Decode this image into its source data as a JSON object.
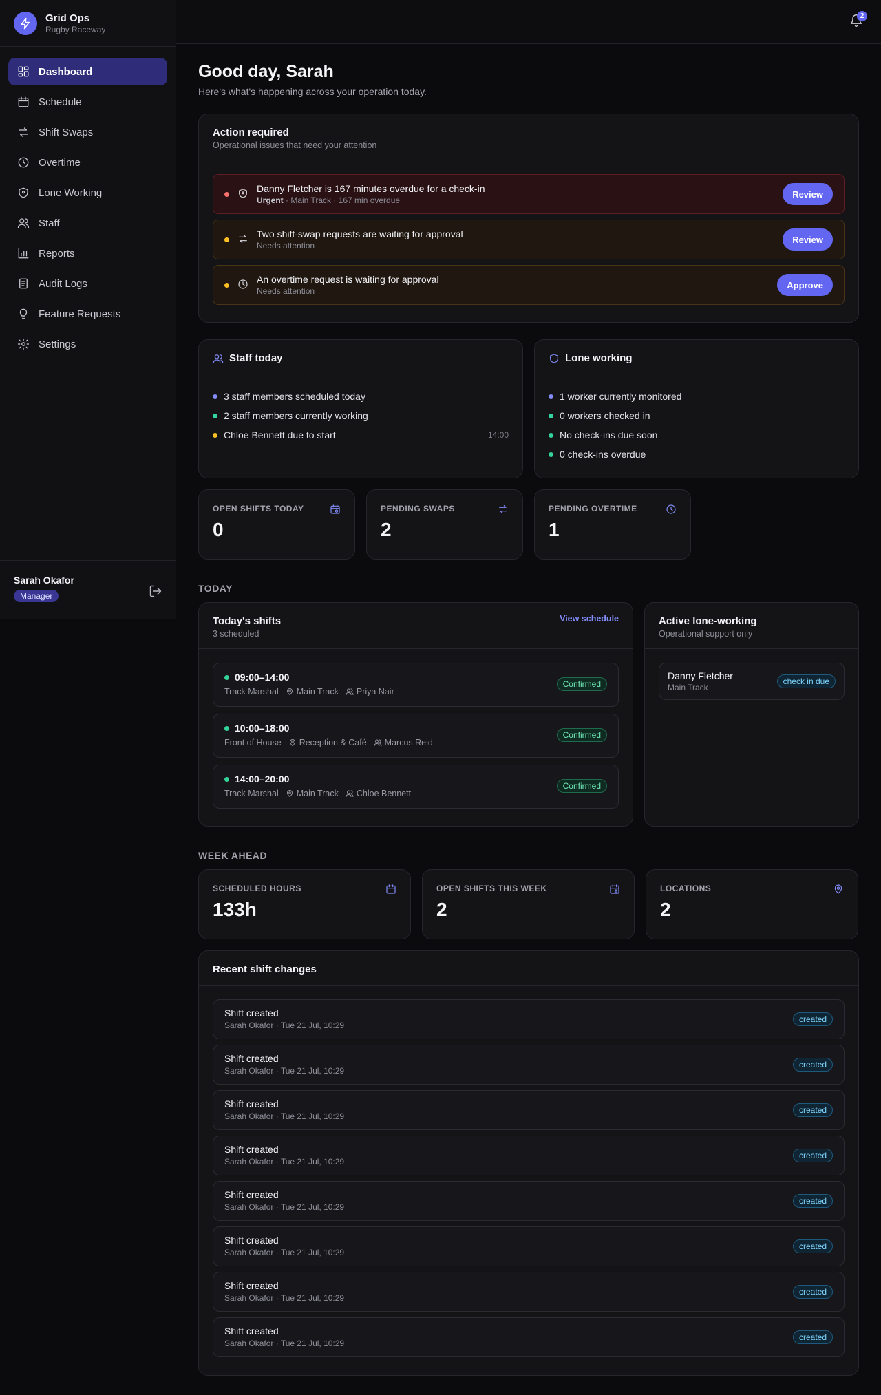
{
  "app": {
    "name": "Grid Ops",
    "venue": "Rugby Raceway"
  },
  "colors": {
    "accent": "#6366f1",
    "urgent": "#f87171",
    "warn": "#fbbf24",
    "ok": "#34d399",
    "info": "#818cf8"
  },
  "sidebar": {
    "items": [
      {
        "label": "Dashboard",
        "icon": "dashboard-icon",
        "active": true
      },
      {
        "label": "Schedule",
        "icon": "calendar-icon"
      },
      {
        "label": "Shift Swaps",
        "icon": "swap-icon"
      },
      {
        "label": "Overtime",
        "icon": "clock-icon"
      },
      {
        "label": "Lone Working",
        "icon": "shield-icon"
      },
      {
        "label": "Staff",
        "icon": "users-icon"
      },
      {
        "label": "Reports",
        "icon": "bar-chart-icon"
      },
      {
        "label": "Audit Logs",
        "icon": "log-icon"
      },
      {
        "label": "Feature Requests",
        "icon": "lightbulb-icon"
      },
      {
        "label": "Settings",
        "icon": "gear-icon"
      }
    ],
    "user": {
      "name": "Sarah Okafor",
      "role": "Manager"
    }
  },
  "topbar": {
    "notifications": "2"
  },
  "header": {
    "greeting": "Good day, Sarah",
    "subtitle": "Here's what's happening across your operation today."
  },
  "actions": {
    "title": "Action required",
    "subtitle": "Operational issues that need your attention",
    "items": [
      {
        "title": "Danny Fletcher is 167 minutes overdue for a check-in",
        "severity": "Urgent",
        "meta": " · Main Track · 167 min overdue",
        "button": "Review"
      },
      {
        "title": "Two shift-swap requests are waiting for approval",
        "meta": "Needs attention",
        "button": "Review"
      },
      {
        "title": "An overtime request is waiting for approval",
        "meta": "Needs attention",
        "button": "Approve"
      }
    ]
  },
  "staff_today": {
    "title": "Staff today",
    "items": [
      {
        "text": "3 staff members scheduled today"
      },
      {
        "text": "2 staff members currently working"
      },
      {
        "text": "Chloe Bennett due to start",
        "time": "14:00"
      }
    ]
  },
  "lone_working": {
    "title": "Lone working",
    "items": [
      {
        "text": "1 worker currently monitored"
      },
      {
        "text": "0 workers checked in"
      },
      {
        "text": "No check-ins due soon"
      },
      {
        "text": "0 check-ins overdue"
      }
    ]
  },
  "stats": [
    {
      "label": "OPEN SHIFTS TODAY",
      "value": "0"
    },
    {
      "label": "PENDING SWAPS",
      "value": "2"
    },
    {
      "label": "PENDING OVERTIME",
      "value": "1"
    }
  ],
  "today": {
    "section": "TODAY",
    "shifts": {
      "title": "Today's shifts",
      "subtitle": "3 scheduled",
      "link": "View schedule",
      "items": [
        {
          "time": "09:00–14:00",
          "role": "Track Marshal",
          "location": "Main Track",
          "person": "Priya Nair",
          "status": "Confirmed"
        },
        {
          "time": "10:00–18:00",
          "role": "Front of House",
          "location": "Reception & Café",
          "person": "Marcus Reid",
          "status": "Confirmed"
        },
        {
          "time": "14:00–20:00",
          "role": "Track Marshal",
          "location": "Main Track",
          "person": "Chloe Bennett",
          "status": "Confirmed"
        }
      ]
    },
    "lone": {
      "title": "Active lone-working",
      "subtitle": "Operational support only",
      "items": [
        {
          "name": "Danny Fletcher",
          "location": "Main Track",
          "status": "check in due"
        }
      ]
    }
  },
  "week": {
    "section": "WEEK AHEAD",
    "stats": [
      {
        "label": "SCHEDULED HOURS",
        "value": "133h"
      },
      {
        "label": "OPEN SHIFTS THIS WEEK",
        "value": "2"
      },
      {
        "label": "LOCATIONS",
        "value": "2"
      }
    ]
  },
  "changes": {
    "title": "Recent shift changes",
    "items": [
      {
        "title": "Shift created",
        "meta": "Sarah Okafor · Tue 21 Jul, 10:29",
        "tag": "created"
      },
      {
        "title": "Shift created",
        "meta": "Sarah Okafor · Tue 21 Jul, 10:29",
        "tag": "created"
      },
      {
        "title": "Shift created",
        "meta": "Sarah Okafor · Tue 21 Jul, 10:29",
        "tag": "created"
      },
      {
        "title": "Shift created",
        "meta": "Sarah Okafor · Tue 21 Jul, 10:29",
        "tag": "created"
      },
      {
        "title": "Shift created",
        "meta": "Sarah Okafor · Tue 21 Jul, 10:29",
        "tag": "created"
      },
      {
        "title": "Shift created",
        "meta": "Sarah Okafor · Tue 21 Jul, 10:29",
        "tag": "created"
      },
      {
        "title": "Shift created",
        "meta": "Sarah Okafor · Tue 21 Jul, 10:29",
        "tag": "created"
      },
      {
        "title": "Shift created",
        "meta": "Sarah Okafor · Tue 21 Jul, 10:29",
        "tag": "created"
      }
    ]
  }
}
